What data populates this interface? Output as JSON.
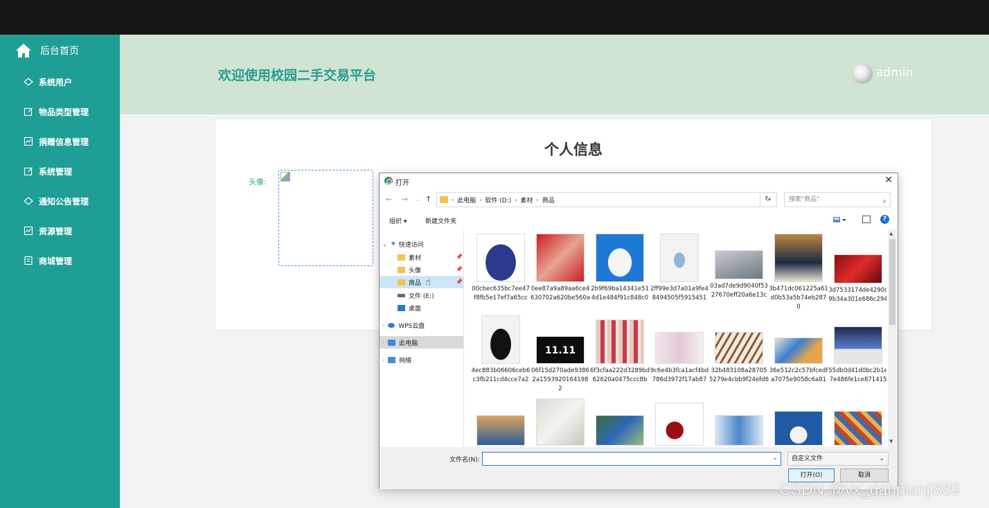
{
  "app": {
    "sidebar": {
      "home_label": "后台首页",
      "items": [
        {
          "label": "系统用户",
          "icon": "diamond-icon"
        },
        {
          "label": "物品类型管理",
          "icon": "edit-icon"
        },
        {
          "label": "捐赠信息管理",
          "icon": "chart-icon"
        },
        {
          "label": "系统管理",
          "icon": "edit-icon"
        },
        {
          "label": "通知公告管理",
          "icon": "diamond-icon"
        },
        {
          "label": "资源管理",
          "icon": "chart-icon"
        },
        {
          "label": "商城管理",
          "icon": "document-icon"
        }
      ]
    },
    "header": {
      "title": "欢迎使用校园二手交易平台",
      "user": "admin"
    },
    "card": {
      "title": "个人信息",
      "avatar_label": "头像:"
    }
  },
  "dialog": {
    "title": "打开",
    "breadcrumb": [
      "此电脑",
      "软件 (D:)",
      "素材",
      "商品"
    ],
    "search_placeholder": "搜索\"商品\"",
    "toolbar": {
      "organize": "组织 ▾",
      "new_folder": "新建文件夹"
    },
    "nav": {
      "quick_access": "快速访问",
      "items": [
        "素材",
        "头像",
        "商品",
        "文件 (E:)",
        "桌面"
      ],
      "wps": "WPS云盘",
      "this_pc": "此电脑",
      "network": "网络"
    },
    "files": [
      {
        "name": "00cbec635bc7ee47f8fb5e17ef7a65cc",
        "thumb": "handbag"
      },
      {
        "name": "0ee87a9a89aa6ce4630702a620be560a",
        "thumb": "nail-polish"
      },
      {
        "name": "2b9f69ba14341e514d1e484f91c848c0",
        "thumb": "sneaker"
      },
      {
        "name": "2ff99e3d7a01a9fe48494505f5915451",
        "thumb": "tshirt"
      },
      {
        "name": "03ad7de9d9040f5327670eff20a6e13c",
        "thumb": "phone"
      },
      {
        "name": "3b471dc061225a61d0b53a5b74eb2870",
        "thumb": "boot"
      },
      {
        "name": "3d7533174de4290c9b34a301e686c294",
        "thumb": "gift-box"
      },
      {
        "name": "4ec883b06606ceb6c3fb211cd4cce7a2",
        "thumb": "dress"
      },
      {
        "name": "06f15d270ade93862a15939201641982",
        "thumb": "sale-banner"
      },
      {
        "name": "6f3cfaa222d3289bd62620a0475ccc8b",
        "thumb": "lipstick"
      },
      {
        "name": "9c6e4b3fca1acf4bd786d3972f17ab87",
        "thumb": "cosmetics"
      },
      {
        "name": "32b483108a287055279e4cbb9f24efd6",
        "thumb": "brushes"
      },
      {
        "name": "36e512c2c57bfcedfa7075e9058c6a81",
        "thumb": "tablet"
      },
      {
        "name": "55db0d41d0bc2b1e7e486fe1ce871415",
        "thumb": "monitor"
      },
      {
        "name": "",
        "thumb": "boat"
      },
      {
        "name": "",
        "thumb": "notebook"
      },
      {
        "name": "",
        "thumb": "smartphone"
      },
      {
        "name": "",
        "thumb": "cherries"
      },
      {
        "name": "",
        "thumb": "skincare"
      },
      {
        "name": "",
        "thumb": "woman"
      },
      {
        "name": "",
        "thumb": "snacks"
      }
    ],
    "filename_label": "文件名(N):",
    "filename_value": "",
    "filetype": "自定义文件",
    "open_button": "打开(O)",
    "cancel_button": "取消"
  },
  "watermark": "CSDN @vx_dahpianji889",
  "colors": {
    "sidebar": "#1f9e95",
    "header_bg": "#cfe4d3",
    "accent": "#2a9d8f",
    "topbar": "#161616"
  }
}
